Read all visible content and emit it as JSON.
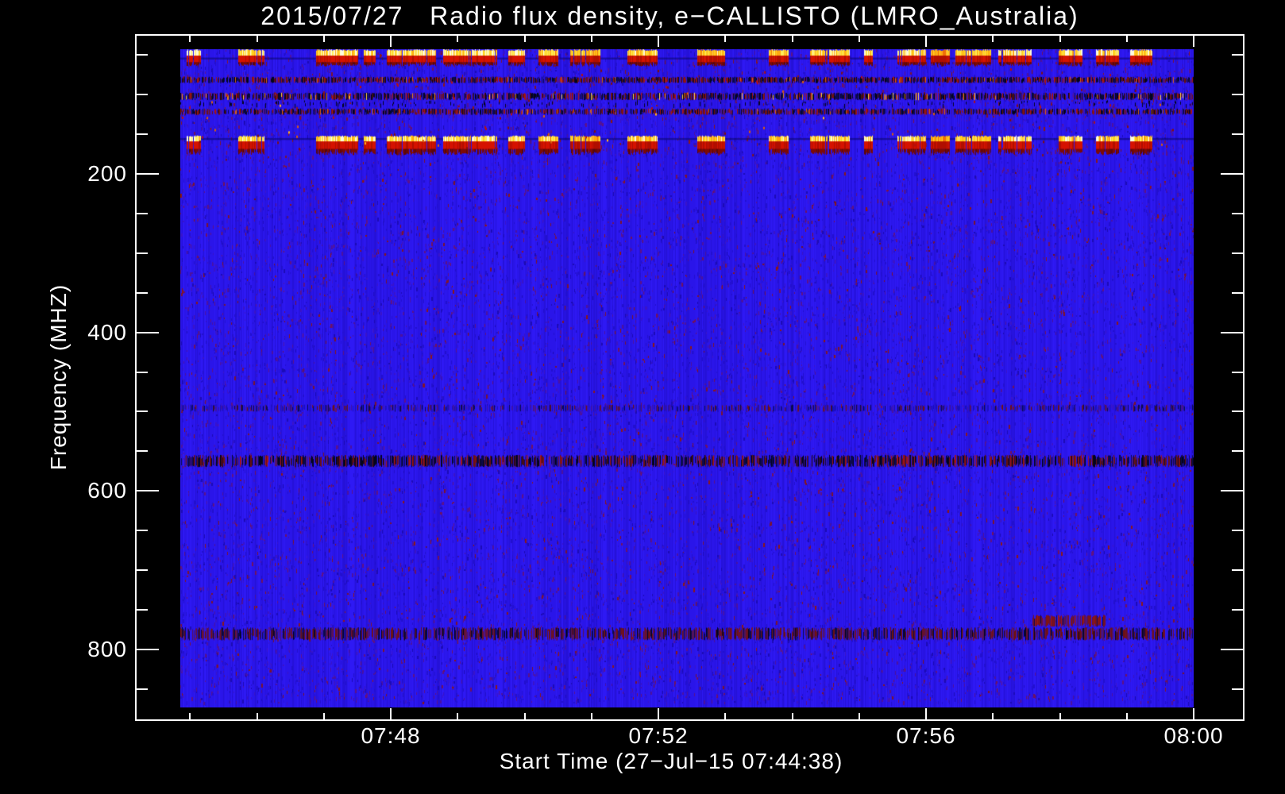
{
  "title": "2015/07/27   Radio flux density, e−CALLISTO (LMRO_Australia)",
  "x_axis": {
    "title": "Start Time (27−Jul−15 07:44:38)",
    "major_tick_labels": [
      "07:48",
      "07:52",
      "07:56",
      "08:00"
    ],
    "minor_tick_interval": "1 minute",
    "start_time": "07:44:38",
    "end_time": "08:00"
  },
  "y_axis": {
    "title": "Frequency (MHZ)",
    "major_tick_labels": [
      "200",
      "400",
      "600",
      "800"
    ],
    "minor_tick_interval_mhz": 50,
    "inverted": true
  },
  "chart_data": {
    "type": "heatmap",
    "title": "2015/07/27   Radio flux density, e−CALLISTO (LMRO_Australia)",
    "xlabel": "Start Time (27−Jul−15 07:44:38)",
    "ylabel": "Frequency (MHZ)",
    "x_range": [
      "07:44:38",
      "08:00:46"
    ],
    "x_major_ticks": [
      "07:48",
      "07:52",
      "07:56",
      "08:00"
    ],
    "y_range_mhz": [
      43,
      873
    ],
    "y_major_ticks_mhz": [
      200,
      400,
      600,
      800
    ],
    "legend": "none",
    "grid": false,
    "description": "Quiet blue solar radio background with two time-correlated intermittent burst/RFI bands near 45-65 MHz and 153-177 MHz (yellow-white cores over red), persistent narrow RFI speckle bands near 80, 100, 120, 495, 560 and 780 MHz, and a reddish enhancement near 760 MHz around 07:57-07:58.",
    "background": {
      "base_columns": [
        [
          "#2a15e9",
          50
        ],
        [
          "#2e19f4",
          27
        ],
        [
          "#2511d8",
          23
        ]
      ],
      "texture_count": 26000,
      "texture_colors": [
        [
          "#2210cf",
          30
        ],
        [
          "#3a14c8",
          22
        ],
        [
          "#4c129f",
          16
        ],
        [
          "#1c0bb6",
          12
        ],
        [
          "#5e1287",
          8
        ],
        [
          "#70125f",
          5
        ],
        [
          "#7a1430",
          4
        ],
        [
          "#8c1818",
          3
        ]
      ]
    },
    "h_lines": [
      {
        "mhz": [
          53.3,
          55.6
        ],
        "color": "#0a0864",
        "alpha": 0.55
      },
      {
        "mhz": [
          154.8,
          157.2
        ],
        "color": "#0a0864",
        "alpha": 0.55
      }
    ],
    "rfi_bands": [
      {
        "name": "80 MHz RFI band",
        "mhz": [
          77.5,
          85.5
        ],
        "density": 0.88,
        "colors": [
          [
            "#0c0a4e",
            28
          ],
          [
            "#04041c",
            20
          ],
          [
            "#6e1212",
            22
          ],
          [
            "#a81414",
            12
          ],
          [
            "#4c129f",
            10
          ],
          [
            "#d86010",
            3
          ],
          [
            "#2a15e9",
            5
          ]
        ]
      },
      {
        "name": "100 MHz RFI band",
        "mhz": [
          97.5,
          107
        ],
        "density": 0.85,
        "colors": [
          [
            "#0c0a4e",
            26
          ],
          [
            "#04041c",
            24
          ],
          [
            "#6e1212",
            16
          ],
          [
            "#a81414",
            8
          ],
          [
            "#4c129f",
            12
          ],
          [
            "#e08818",
            5
          ],
          [
            "#ffd24a",
            3
          ],
          [
            "#2a15e9",
            6
          ]
        ],
        "under_ticks": {
          "count": 170,
          "mhz": [
            107,
            115
          ],
          "color": "#04041c"
        }
      },
      {
        "name": "120 MHz RFI band",
        "mhz": [
          117.5,
          125.5
        ],
        "density": 0.85,
        "colors": [
          [
            "#0c0a4e",
            26
          ],
          [
            "#04041c",
            18
          ],
          [
            "#6e1212",
            24
          ],
          [
            "#a81414",
            10
          ],
          [
            "#4c129f",
            12
          ],
          [
            "#d86010",
            3
          ],
          [
            "#2a15e9",
            7
          ]
        ]
      },
      {
        "name": "495 MHz band",
        "mhz": [
          491,
          500
        ],
        "density": 0.6,
        "colors": [
          [
            "#1a0fbd",
            34
          ],
          [
            "#0c0a4e",
            18
          ],
          [
            "#3d12a8",
            22
          ],
          [
            "#6e1212",
            14
          ],
          [
            "#531260",
            6
          ],
          [
            "#2a15e9",
            6
          ]
        ]
      },
      {
        "name": "560 MHz band",
        "mhz": [
          554.5,
          570
        ],
        "density": 0.85,
        "colors": [
          [
            "#04041c",
            24
          ],
          [
            "#0c0a4e",
            28
          ],
          [
            "#6e1212",
            20
          ],
          [
            "#a81414",
            10
          ],
          [
            "#3d12a8",
            10
          ],
          [
            "#2a15e9",
            8
          ]
        ]
      },
      {
        "name": "780 MHz band",
        "mhz": [
          772,
          788.5
        ],
        "density": 0.8,
        "colors": [
          [
            "#53125f",
            20
          ],
          [
            "#6e1030",
            16
          ],
          [
            "#6e1212",
            22
          ],
          [
            "#0c0a4e",
            22
          ],
          [
            "#04041c",
            10
          ],
          [
            "#2a15e9",
            10
          ]
        ]
      }
    ],
    "red_patch": {
      "t": [
        0.841,
        0.912
      ],
      "mhz": [
        756.5,
        771.5
      ],
      "density": 0.85,
      "colors": [
        [
          "#7e1414",
          40
        ],
        [
          "#6e1030",
          18
        ],
        [
          "#a01616",
          14
        ],
        [
          "#53125f",
          12
        ],
        [
          "#0c0a4e",
          8
        ],
        [
          "#2a15e9",
          8
        ]
      ]
    },
    "burst_bands": [
      {
        "name": "low band bursts",
        "bright_mhz": [
          43.8,
          51.8
        ],
        "red_mhz": [
          51.8,
          60
        ],
        "fade_mhz": [
          60,
          65.5
        ]
      },
      {
        "name": "high band bursts",
        "bright_mhz": [
          152.5,
          160
        ],
        "red_mhz": [
          160,
          169.5
        ],
        "fade_mhz": [
          169.5,
          177.5
        ]
      }
    ],
    "burst_colors": {
      "white": "#fffbdc",
      "bright_yellow": "#ffee5a",
      "yellow": "#ffd020",
      "gold": "#ffa810",
      "orange": "#f07008",
      "orange_red": "#e83c04",
      "red": "#d51200",
      "dim_red": "#b00e00",
      "dark_red": "#7c0a05",
      "deep_red": "#58070a"
    },
    "burst_patches": [
      {
        "t0": 0.0063,
        "t1": 0.0196
      },
      {
        "t0": 0.0572,
        "t1": 0.0823
      },
      {
        "t0": 0.134,
        "t1": 0.1748
      },
      {
        "t0": 0.181,
        "t1": 0.192
      },
      {
        "t0": 0.2038,
        "t1": 0.2516
      },
      {
        "t0": 0.2594,
        "t1": 0.3119
      },
      {
        "t0": 0.3237,
        "t1": 0.3393
      },
      {
        "t0": 0.3534,
        "t1": 0.3723
      },
      {
        "t0": 0.3848,
        "t1": 0.4138
      },
      {
        "t0": 0.4412,
        "t1": 0.471
      },
      {
        "t0": 0.5102,
        "t1": 0.5368
      },
      {
        "t0": 0.5808,
        "t1": 0.5996
      },
      {
        "t0": 0.6215,
        "t1": 0.6607
      },
      {
        "t0": 0.6748,
        "t1": 0.6826
      },
      {
        "t0": 0.7077,
        "t1": 0.7351
      },
      {
        "t0": 0.7406,
        "t1": 0.7586
      },
      {
        "t0": 0.7649,
        "t1": 0.7994
      },
      {
        "t0": 0.8072,
        "t1": 0.8393
      },
      {
        "t0": 0.8668,
        "t1": 0.8895
      },
      {
        "t0": 0.9036,
        "t1": 0.9255
      },
      {
        "t0": 0.9373,
        "t1": 0.9585
      }
    ],
    "speckle_dots": [
      {
        "count": 95,
        "mhz": [
          66,
          170
        ],
        "w": 2,
        "h": 3,
        "colors": [
          [
            "#b41212",
            38
          ],
          [
            "#d85c10",
            18
          ],
          [
            "#ffb020",
            8
          ],
          [
            "#801010",
            36
          ]
        ]
      },
      {
        "count": 46,
        "mhz": [
          180,
          330
        ],
        "w": 2,
        "h": 2,
        "colors": [
          [
            "#6e1022",
            55
          ],
          [
            "#8c1430",
            45
          ]
        ]
      },
      {
        "count": 20,
        "mhz": [
          690,
          768
        ],
        "w": 2,
        "h": 2,
        "colors": [
          [
            "#6e1022",
            50
          ],
          [
            "#8c1430",
            30
          ],
          [
            "#a01616",
            20
          ]
        ]
      }
    ]
  }
}
